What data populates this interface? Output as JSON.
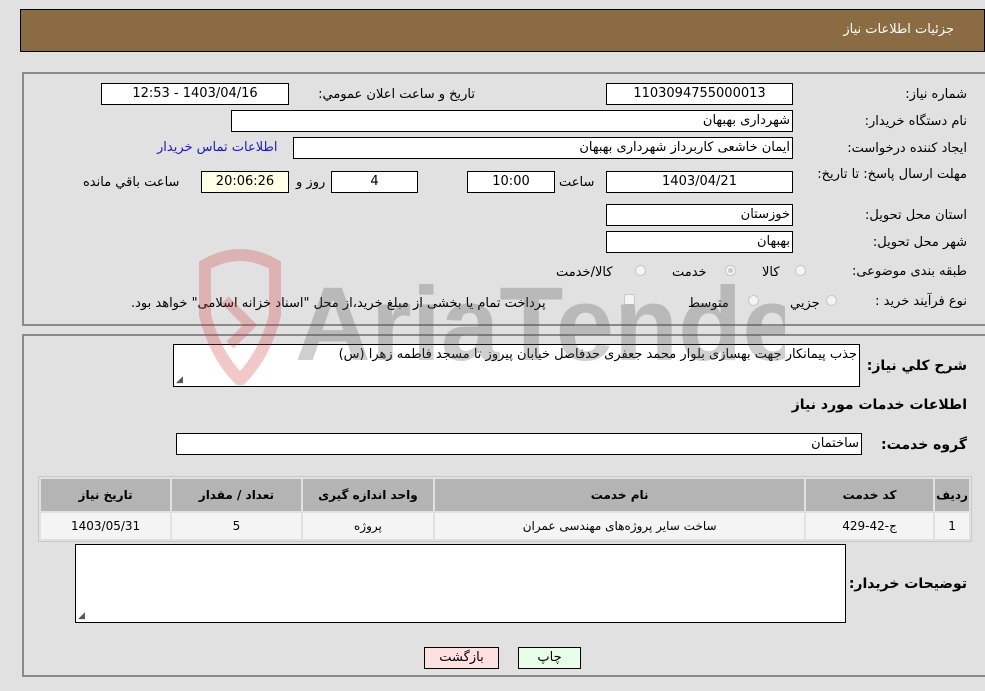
{
  "header": {
    "title": "جزئيات اطلاعات نياز"
  },
  "form": {
    "need_number": {
      "label": "شماره نياز:",
      "value": "1103094755000013"
    },
    "announce_datetime": {
      "label": "تاريخ و ساعت اعلان عمومي:",
      "value": "1403/04/16 - 12:53"
    },
    "buyer_org": {
      "label": "نام دستگاه خريدار:",
      "value": "شهرداری بهبهان"
    },
    "requester": {
      "label": "ايجاد کننده درخواست:",
      "value": "ايمان خاشعی کاربرداز شهرداری بهبهان"
    },
    "buyer_contact_link": "اطلاعات تماس خريدار",
    "deadline": {
      "label": "مهلت ارسال پاسخ: تا تاريخ:",
      "date": "1403/04/21",
      "time_label": "ساعت",
      "time": "10:00",
      "days": "4",
      "days_label": "روز و",
      "remaining": "20:06:26",
      "remaining_label": "ساعت باقي مانده"
    },
    "province": {
      "label": "استان محل تحويل:",
      "value": "خوزستان"
    },
    "city": {
      "label": "شهر محل تحويل:",
      "value": "بهبهان"
    },
    "category": {
      "label": "طبقه بندی موضوعی:",
      "options": [
        "کالا",
        "خدمت",
        "کالا/خدمت"
      ],
      "selected": "خدمت"
    },
    "purchase_type": {
      "label": "نوع فرآيند خريد :",
      "options": [
        "جزيي",
        "متوسط"
      ],
      "selected": "",
      "treasury_checkbox_label": "پرداخت تمام يا بخشی از مبلغ خريد،از محل \"اسناد خزانه اسلامی\" خواهد بود.",
      "treasury_checked": false
    }
  },
  "details": {
    "description_label": "شرح کلي نياز:",
    "description": "جذب پیمانکار جهت بهسازی بلوار محمد جعفری حدفاصل خیابان پیروز تا مسجد فاطمه زهرا (س)",
    "services_heading": "اطلاعات خدمات مورد نياز",
    "service_group_label": "گروه خدمت:",
    "service_group": "ساختمان",
    "table": {
      "headers": [
        "رديف",
        "کد خدمت",
        "نام خدمت",
        "واحد اندازه گيری",
        "تعداد / مقدار",
        "تاريخ نياز"
      ],
      "rows": [
        [
          "1",
          "ج-42-429",
          "ساخت ساير پروژه‌های مهندسی عمران",
          "پروژه",
          "5",
          "1403/05/31"
        ]
      ]
    },
    "buyer_notes_label": "توضيحات خريدار:",
    "buyer_notes": ""
  },
  "buttons": {
    "print": "چاپ",
    "back": "بازگشت"
  },
  "colors": {
    "header_bg": "#8b6b41",
    "print_bg": "#e8ffe8",
    "back_bg": "#ffe0e0",
    "link": "#1a1ac8"
  },
  "watermark": {
    "text": "AriaTender.neT"
  }
}
